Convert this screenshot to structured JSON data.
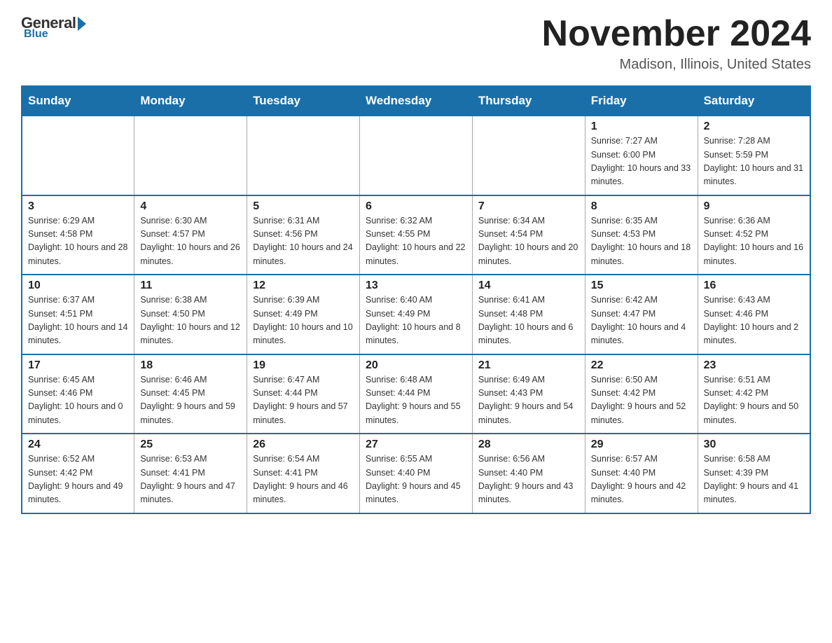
{
  "logo": {
    "general": "General",
    "blue": "Blue",
    "subtitle": "Blue"
  },
  "header": {
    "title": "November 2024",
    "location": "Madison, Illinois, United States"
  },
  "weekdays": [
    "Sunday",
    "Monday",
    "Tuesday",
    "Wednesday",
    "Thursday",
    "Friday",
    "Saturday"
  ],
  "weeks": [
    [
      {
        "day": "",
        "info": ""
      },
      {
        "day": "",
        "info": ""
      },
      {
        "day": "",
        "info": ""
      },
      {
        "day": "",
        "info": ""
      },
      {
        "day": "",
        "info": ""
      },
      {
        "day": "1",
        "info": "Sunrise: 7:27 AM\nSunset: 6:00 PM\nDaylight: 10 hours and 33 minutes."
      },
      {
        "day": "2",
        "info": "Sunrise: 7:28 AM\nSunset: 5:59 PM\nDaylight: 10 hours and 31 minutes."
      }
    ],
    [
      {
        "day": "3",
        "info": "Sunrise: 6:29 AM\nSunset: 4:58 PM\nDaylight: 10 hours and 28 minutes."
      },
      {
        "day": "4",
        "info": "Sunrise: 6:30 AM\nSunset: 4:57 PM\nDaylight: 10 hours and 26 minutes."
      },
      {
        "day": "5",
        "info": "Sunrise: 6:31 AM\nSunset: 4:56 PM\nDaylight: 10 hours and 24 minutes."
      },
      {
        "day": "6",
        "info": "Sunrise: 6:32 AM\nSunset: 4:55 PM\nDaylight: 10 hours and 22 minutes."
      },
      {
        "day": "7",
        "info": "Sunrise: 6:34 AM\nSunset: 4:54 PM\nDaylight: 10 hours and 20 minutes."
      },
      {
        "day": "8",
        "info": "Sunrise: 6:35 AM\nSunset: 4:53 PM\nDaylight: 10 hours and 18 minutes."
      },
      {
        "day": "9",
        "info": "Sunrise: 6:36 AM\nSunset: 4:52 PM\nDaylight: 10 hours and 16 minutes."
      }
    ],
    [
      {
        "day": "10",
        "info": "Sunrise: 6:37 AM\nSunset: 4:51 PM\nDaylight: 10 hours and 14 minutes."
      },
      {
        "day": "11",
        "info": "Sunrise: 6:38 AM\nSunset: 4:50 PM\nDaylight: 10 hours and 12 minutes."
      },
      {
        "day": "12",
        "info": "Sunrise: 6:39 AM\nSunset: 4:49 PM\nDaylight: 10 hours and 10 minutes."
      },
      {
        "day": "13",
        "info": "Sunrise: 6:40 AM\nSunset: 4:49 PM\nDaylight: 10 hours and 8 minutes."
      },
      {
        "day": "14",
        "info": "Sunrise: 6:41 AM\nSunset: 4:48 PM\nDaylight: 10 hours and 6 minutes."
      },
      {
        "day": "15",
        "info": "Sunrise: 6:42 AM\nSunset: 4:47 PM\nDaylight: 10 hours and 4 minutes."
      },
      {
        "day": "16",
        "info": "Sunrise: 6:43 AM\nSunset: 4:46 PM\nDaylight: 10 hours and 2 minutes."
      }
    ],
    [
      {
        "day": "17",
        "info": "Sunrise: 6:45 AM\nSunset: 4:46 PM\nDaylight: 10 hours and 0 minutes."
      },
      {
        "day": "18",
        "info": "Sunrise: 6:46 AM\nSunset: 4:45 PM\nDaylight: 9 hours and 59 minutes."
      },
      {
        "day": "19",
        "info": "Sunrise: 6:47 AM\nSunset: 4:44 PM\nDaylight: 9 hours and 57 minutes."
      },
      {
        "day": "20",
        "info": "Sunrise: 6:48 AM\nSunset: 4:44 PM\nDaylight: 9 hours and 55 minutes."
      },
      {
        "day": "21",
        "info": "Sunrise: 6:49 AM\nSunset: 4:43 PM\nDaylight: 9 hours and 54 minutes."
      },
      {
        "day": "22",
        "info": "Sunrise: 6:50 AM\nSunset: 4:42 PM\nDaylight: 9 hours and 52 minutes."
      },
      {
        "day": "23",
        "info": "Sunrise: 6:51 AM\nSunset: 4:42 PM\nDaylight: 9 hours and 50 minutes."
      }
    ],
    [
      {
        "day": "24",
        "info": "Sunrise: 6:52 AM\nSunset: 4:42 PM\nDaylight: 9 hours and 49 minutes."
      },
      {
        "day": "25",
        "info": "Sunrise: 6:53 AM\nSunset: 4:41 PM\nDaylight: 9 hours and 47 minutes."
      },
      {
        "day": "26",
        "info": "Sunrise: 6:54 AM\nSunset: 4:41 PM\nDaylight: 9 hours and 46 minutes."
      },
      {
        "day": "27",
        "info": "Sunrise: 6:55 AM\nSunset: 4:40 PM\nDaylight: 9 hours and 45 minutes."
      },
      {
        "day": "28",
        "info": "Sunrise: 6:56 AM\nSunset: 4:40 PM\nDaylight: 9 hours and 43 minutes."
      },
      {
        "day": "29",
        "info": "Sunrise: 6:57 AM\nSunset: 4:40 PM\nDaylight: 9 hours and 42 minutes."
      },
      {
        "day": "30",
        "info": "Sunrise: 6:58 AM\nSunset: 4:39 PM\nDaylight: 9 hours and 41 minutes."
      }
    ]
  ]
}
